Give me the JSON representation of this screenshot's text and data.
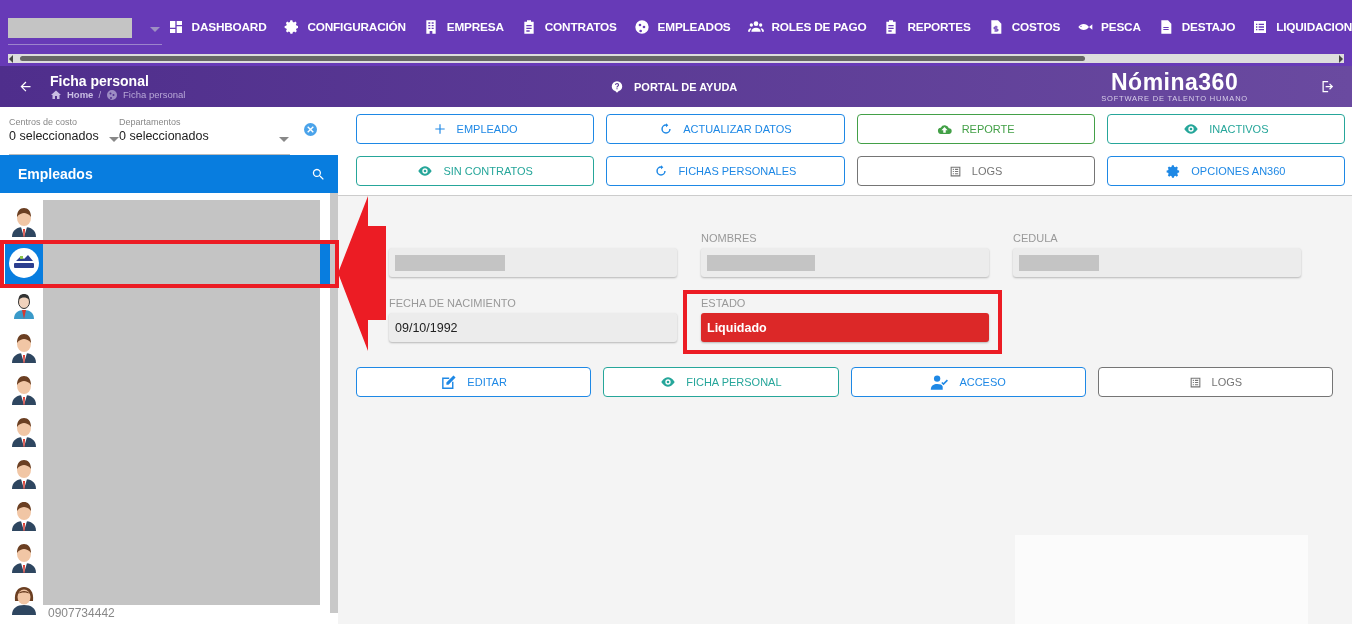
{
  "top_bar": {
    "nav": [
      {
        "label": "DASHBOARD"
      },
      {
        "label": "CONFIGURACIÓN"
      },
      {
        "label": "EMPRESA"
      },
      {
        "label": "CONTRATOS"
      },
      {
        "label": "EMPLEADOS"
      },
      {
        "label": "ROLES DE PAGO"
      },
      {
        "label": "REPORTES"
      },
      {
        "label": "COSTOS"
      },
      {
        "label": "PESCA"
      },
      {
        "label": "DESTAJO"
      },
      {
        "label": "LIQUIDACION"
      }
    ]
  },
  "header": {
    "title": "Ficha personal",
    "breadcrumb": [
      "Home",
      "Ficha personal"
    ],
    "breadcrumb_separator": "/",
    "help": "PORTAL DE AYUDA",
    "logo": "Nómina360",
    "logo_subtitle": "SOFTWARE DE TALENTO HUMANO"
  },
  "filters": [
    {
      "label": "Centros de costo",
      "value": "0 seleccionados"
    },
    {
      "label": "Departamentos",
      "value": "0 seleccionados"
    }
  ],
  "employees": {
    "title": "Empleados",
    "rows": [
      {
        "kind": "man",
        "selected": false
      },
      {
        "kind": "company",
        "selected": true
      },
      {
        "kind": "agent",
        "selected": false
      },
      {
        "kind": "man",
        "selected": false
      },
      {
        "kind": "man",
        "selected": false
      },
      {
        "kind": "man",
        "selected": false
      },
      {
        "kind": "man",
        "selected": false
      },
      {
        "kind": "man",
        "selected": false
      },
      {
        "kind": "man",
        "selected": false
      },
      {
        "kind": "woman",
        "selected": false,
        "text": "0907734442"
      }
    ]
  },
  "toolbar": [
    {
      "label": "EMPLEADO",
      "color": "#1e88e5"
    },
    {
      "label": "ACTUALIZAR DATOS",
      "color": "#1e88e5"
    },
    {
      "label": "REPORTE",
      "color": "#43a047"
    },
    {
      "label": "INACTIVOS",
      "color": "#26a69a"
    },
    {
      "label": "SIN CONTRATOS",
      "color": "#26a69a"
    },
    {
      "label": "FICHAS PERSONALES",
      "color": "#1e88e5"
    },
    {
      "label": "LOGS",
      "color": "#757575"
    },
    {
      "label": "OPCIONES AN360",
      "color": "#1e88e5"
    }
  ],
  "form": {
    "fields": [
      {
        "kind": "field"
      },
      {
        "kind": "field",
        "label": "NOMBRES"
      },
      {
        "kind": "field",
        "label": "CEDULA"
      },
      {
        "kind": "field",
        "label": "FECHA DE NACIMIENTO",
        "value": "09/10/1992"
      },
      {
        "kind": "status",
        "label": "ESTADO",
        "value": "Liquidado"
      }
    ]
  },
  "actions": [
    {
      "label": "EDITAR",
      "color": "#1e88e5"
    },
    {
      "label": "FICHA PERSONAL",
      "color": "#26a69a"
    },
    {
      "label": "ACCESO",
      "color": "#1e88e5"
    },
    {
      "label": "LOGS",
      "color": "#757575"
    }
  ]
}
